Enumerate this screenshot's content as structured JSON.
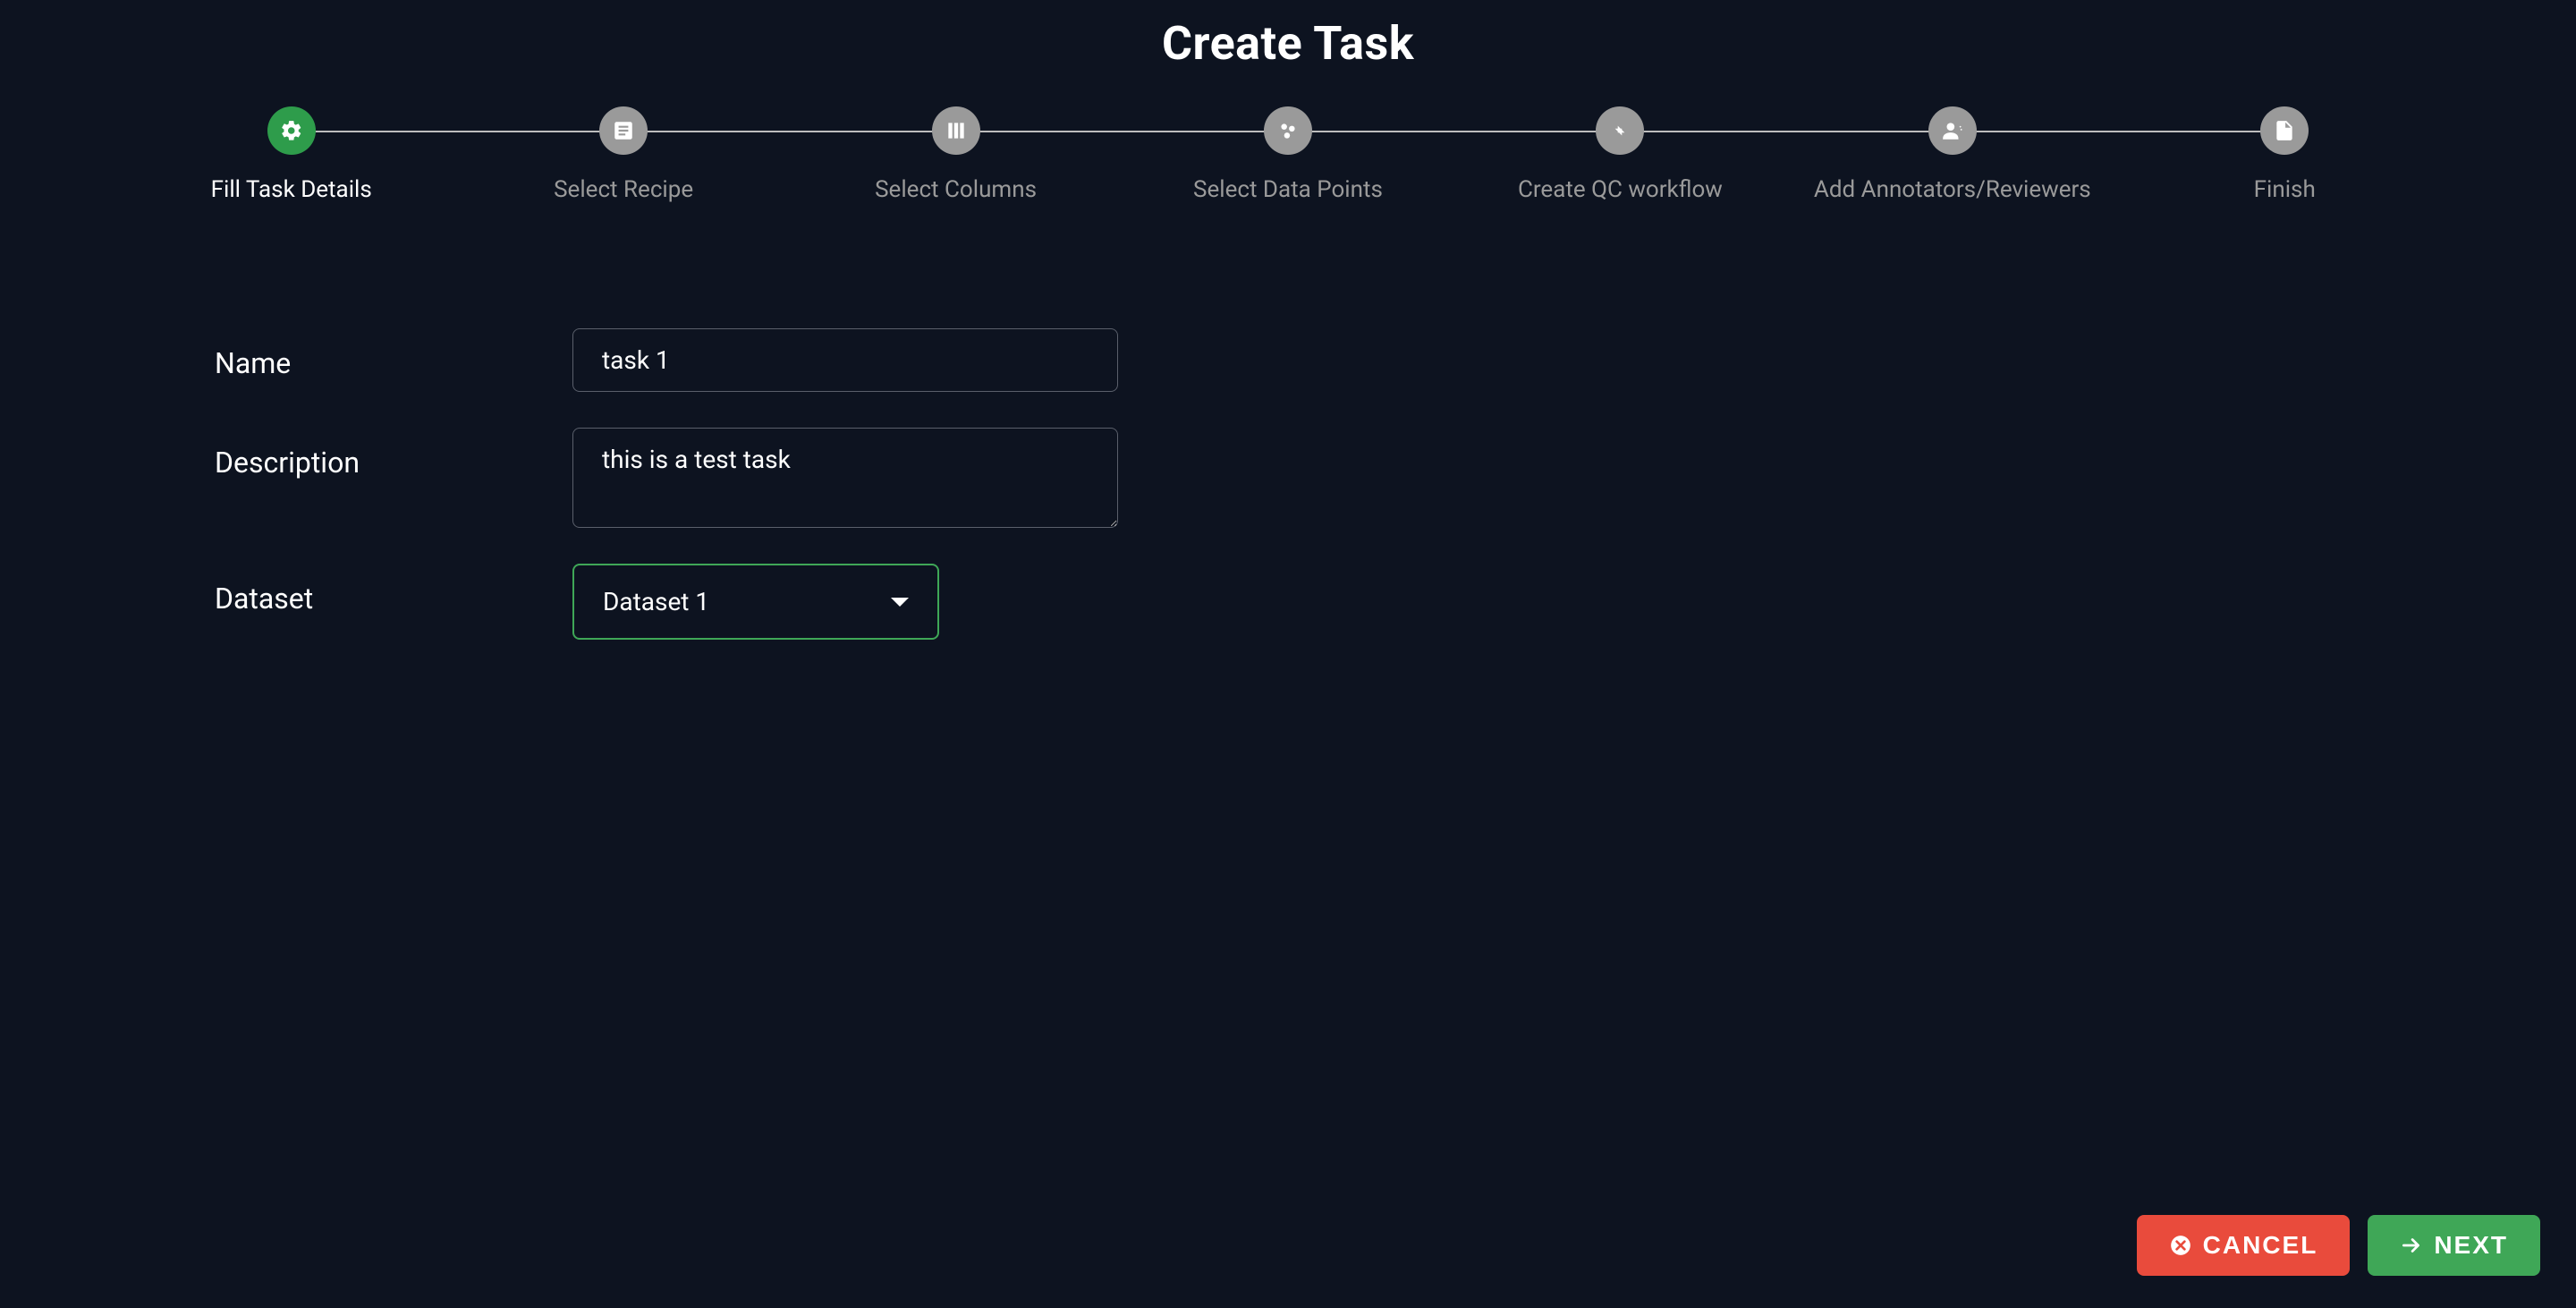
{
  "title": "Create Task",
  "stepper": [
    {
      "label": "Fill Task Details",
      "icon": "gear",
      "active": true
    },
    {
      "label": "Select Recipe",
      "icon": "recipe",
      "active": false
    },
    {
      "label": "Select Columns",
      "icon": "columns",
      "active": false
    },
    {
      "label": "Select Data Points",
      "icon": "dots",
      "active": false
    },
    {
      "label": "Create QC workflow",
      "icon": "merge",
      "active": false
    },
    {
      "label": "Add Annotators/Reviewers",
      "icon": "people",
      "active": false
    },
    {
      "label": "Finish",
      "icon": "file",
      "active": false
    }
  ],
  "form": {
    "name_label": "Name",
    "name_value": "task 1",
    "description_label": "Description",
    "description_value": "this is a test task",
    "dataset_label": "Dataset",
    "dataset_value": "Dataset 1"
  },
  "buttons": {
    "cancel": "CANCEL",
    "next": "NEXT"
  }
}
